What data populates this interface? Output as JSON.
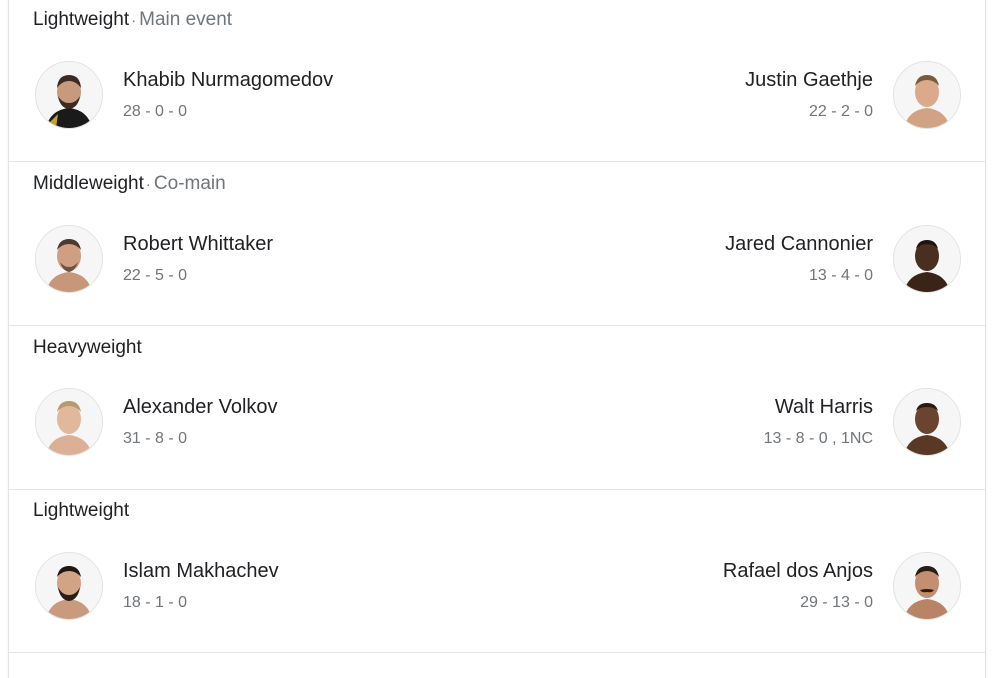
{
  "fights": [
    {
      "division": "Lightweight",
      "billing": "Main event",
      "left": {
        "name": "Khabib Nurmagomedov",
        "record": "28 - 0 - 0",
        "icon": "fighter-photo"
      },
      "right": {
        "name": "Justin Gaethje",
        "record": "22 - 2 - 0",
        "icon": "fighter-photo"
      }
    },
    {
      "division": "Middleweight",
      "billing": "Co-main",
      "left": {
        "name": "Robert Whittaker",
        "record": "22 - 5 - 0",
        "icon": "fighter-photo"
      },
      "right": {
        "name": "Jared Cannonier",
        "record": "13 - 4 - 0",
        "icon": "fighter-photo"
      }
    },
    {
      "division": "Heavyweight",
      "billing": "",
      "left": {
        "name": "Alexander Volkov",
        "record": "31 - 8 - 0",
        "icon": "fighter-photo"
      },
      "right": {
        "name": "Walt Harris",
        "record": "13 - 8 - 0 , 1NC",
        "icon": "fighter-photo"
      }
    },
    {
      "division": "Lightweight",
      "billing": "",
      "left": {
        "name": "Islam Makhachev",
        "record": "18 - 1 - 0",
        "icon": "fighter-photo"
      },
      "right": {
        "name": "Rafael dos Anjos",
        "record": "29 - 13 - 0",
        "icon": "fighter-photo"
      }
    }
  ],
  "colors": {
    "text_primary": "#202124",
    "text_secondary": "#70757a",
    "divider": "#e5e5e5"
  }
}
